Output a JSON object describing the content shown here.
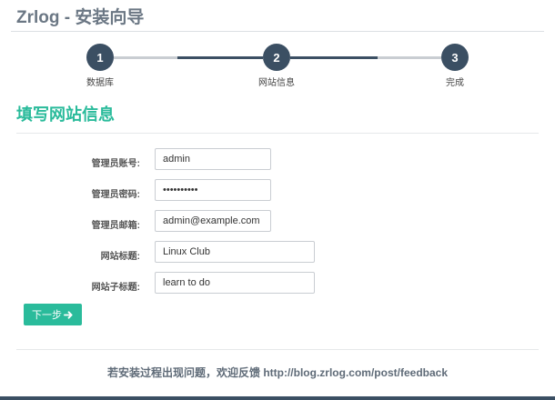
{
  "header": {
    "title": "Zrlog - 安装向导"
  },
  "wizard": {
    "steps": [
      {
        "number": "1",
        "label": "数据库"
      },
      {
        "number": "2",
        "label": "网站信息"
      },
      {
        "number": "3",
        "label": "完成"
      }
    ],
    "colors": {
      "done": "#3b4f63",
      "pending": "#c9cdd2"
    }
  },
  "form": {
    "section_title": "填写网站信息",
    "fields": [
      {
        "label": "管理员账号:",
        "value": "admin",
        "type": "text"
      },
      {
        "label": "管理员密码:",
        "value": "••••••••••",
        "type": "password"
      },
      {
        "label": "管理员邮箱:",
        "value": "admin@example.com",
        "type": "email"
      },
      {
        "label": "网站标题:",
        "value": "Linux Club",
        "type": "text"
      },
      {
        "label": "网站子标题:",
        "value": "learn to do",
        "type": "text"
      }
    ],
    "next_button": "下一步",
    "next_icon": "arrow-right-icon"
  },
  "footer": {
    "text": "若安装过程出现问题，欢迎反馈 ",
    "link": "http://blog.zrlog.com/post/feedback"
  },
  "colors": {
    "accent": "#2abb9b",
    "dark": "#3b4f63"
  }
}
